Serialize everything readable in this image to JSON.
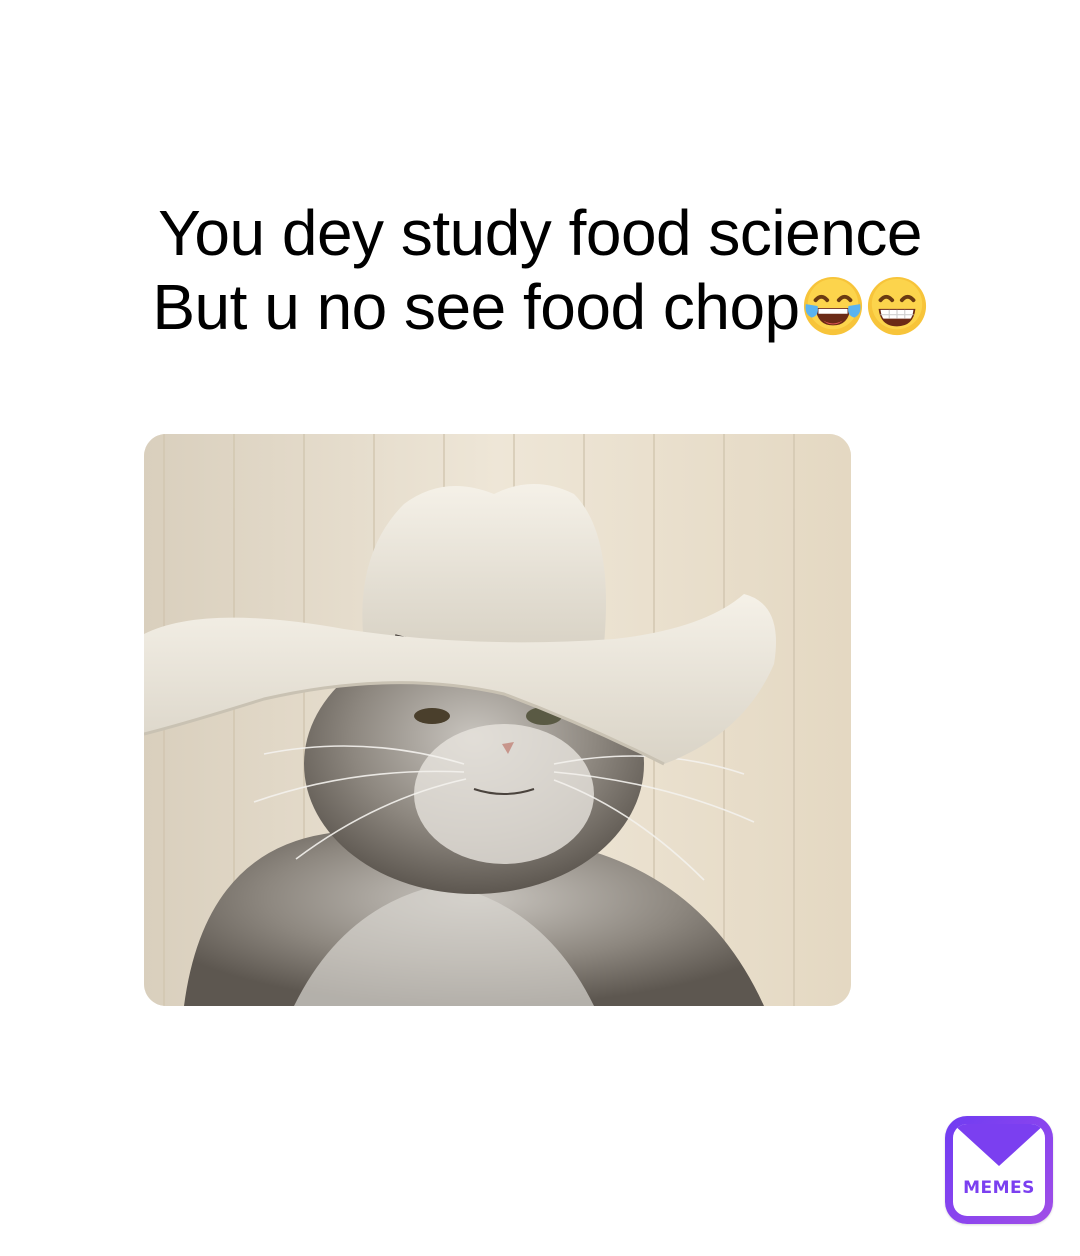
{
  "caption": {
    "line1": "You dey study food science",
    "line2": "But u no see food chop",
    "emojis": [
      "face-with-tears-of-joy",
      "grinning-face-with-smiling-eyes"
    ]
  },
  "image": {
    "subject": "cat-in-cowboy-hat"
  },
  "watermark": {
    "text": "MEMES",
    "colors": {
      "gradient_start": "#6f3cf2",
      "gradient_end": "#a14fe6"
    }
  }
}
